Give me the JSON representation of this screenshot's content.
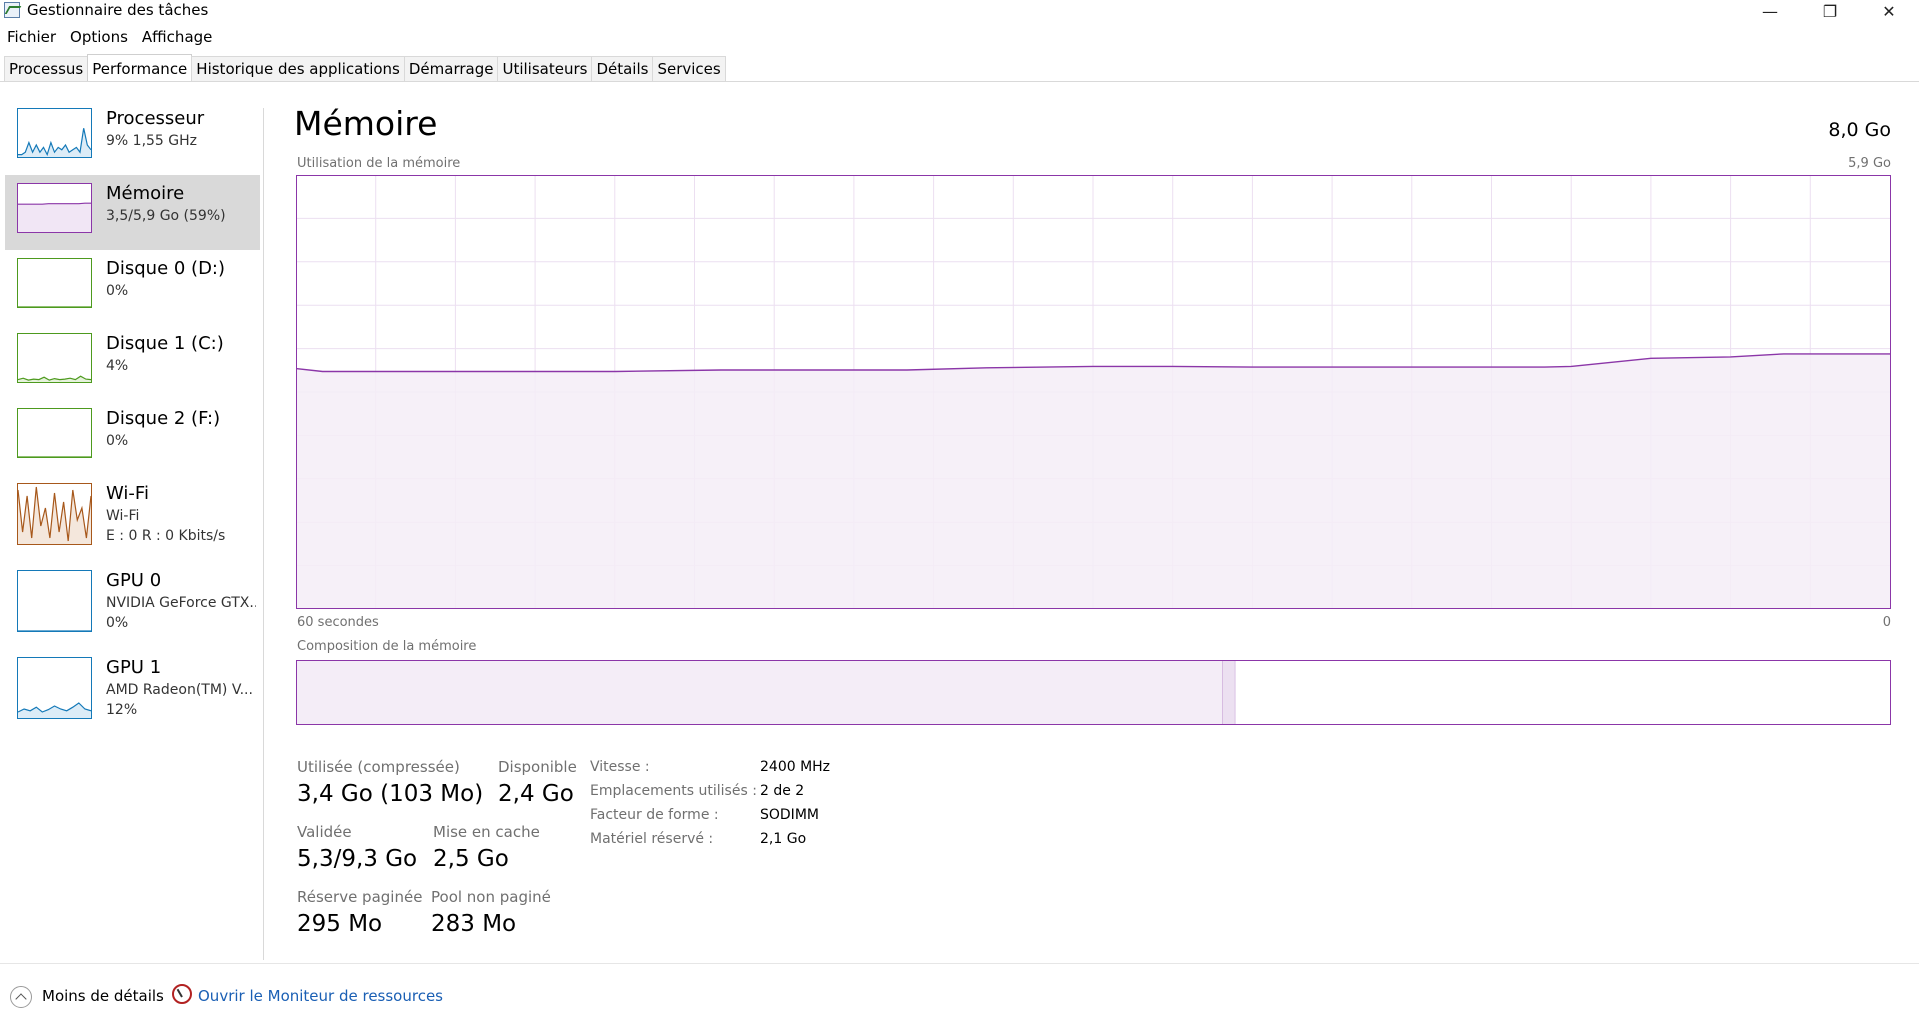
{
  "window": {
    "title": "Gestionnaire des tâches",
    "min_glyph": "—",
    "max_glyph": "❐",
    "close_glyph": "✕"
  },
  "menu": [
    "Fichier",
    "Options",
    "Affichage"
  ],
  "tabs": [
    {
      "label": "Processus",
      "active": false
    },
    {
      "label": "Performance",
      "active": true
    },
    {
      "label": "Historique des applications",
      "active": false
    },
    {
      "label": "Démarrage",
      "active": false
    },
    {
      "label": "Utilisateurs",
      "active": false
    },
    {
      "label": "Détails",
      "active": false
    },
    {
      "label": "Services",
      "active": false
    }
  ],
  "sidebar": {
    "items": [
      {
        "name": "Processeur",
        "sub": "9%  1,55 GHz",
        "sub2": "",
        "color": "#1479b8",
        "fill": "#dcecf7",
        "selected": false,
        "spark": [
          0.05,
          0.05,
          0.1,
          0.3,
          0.1,
          0.25,
          0.1,
          0.2,
          0.05,
          0.3,
          0.1,
          0.2,
          0.15,
          0.25,
          0.1,
          0.15,
          0.2,
          0.1,
          0.6,
          0.25,
          0.15
        ]
      },
      {
        "name": "Mémoire",
        "sub": "3,5/5,9 Go (59%)",
        "sub2": "",
        "color": "#8b36a8",
        "fill": "#f1e6f5",
        "selected": true,
        "spark": [
          0.58,
          0.58,
          0.58,
          0.58,
          0.58,
          0.59,
          0.59,
          0.59,
          0.59,
          0.59,
          0.59,
          0.6,
          0.6
        ]
      },
      {
        "name": "Disque 0 (D:)",
        "sub": "0%",
        "sub2": "",
        "color": "#4d9a1e",
        "fill": "#e6f2dc",
        "selected": false,
        "spark": [
          0,
          0,
          0,
          0,
          0,
          0,
          0,
          0,
          0,
          0
        ]
      },
      {
        "name": "Disque 1 (C:)",
        "sub": "4%",
        "sub2": "",
        "color": "#4d9a1e",
        "fill": "#e6f2dc",
        "selected": false,
        "spark": [
          0.05,
          0.08,
          0.04,
          0.06,
          0.05,
          0.1,
          0.04,
          0.07,
          0.05,
          0.06,
          0.08,
          0.05,
          0.12,
          0.06,
          0.05
        ]
      },
      {
        "name": "Disque 2 (F:)",
        "sub": "0%",
        "sub2": "",
        "color": "#4d9a1e",
        "fill": "#e6f2dc",
        "selected": false,
        "spark": [
          0,
          0,
          0,
          0,
          0,
          0,
          0,
          0,
          0,
          0
        ]
      },
      {
        "name": "Wi-Fi",
        "sub": "Wi-Fi",
        "sub2": "E : 0  R : 0 Kbits/s",
        "color": "#a7581b",
        "fill": "#f4e7dc",
        "selected": false,
        "spark": [
          0.9,
          0.2,
          0.8,
          0.1,
          0.95,
          0.3,
          0.6,
          0.1,
          0.85,
          0.2,
          0.7,
          0.05,
          0.9,
          0.4,
          0.6,
          0.1,
          0.8
        ]
      },
      {
        "name": "GPU 0",
        "sub": "NVIDIA GeForce GTX...",
        "sub2": "0%",
        "color": "#1479b8",
        "fill": "#dcecf7",
        "selected": false,
        "spark": [
          0,
          0,
          0,
          0,
          0,
          0,
          0,
          0,
          0,
          0
        ]
      },
      {
        "name": "GPU 1",
        "sub": "AMD Radeon(TM) V...",
        "sub2": "12%",
        "color": "#1479b8",
        "fill": "#dcecf7",
        "selected": false,
        "spark": [
          0.1,
          0.15,
          0.12,
          0.18,
          0.1,
          0.14,
          0.2,
          0.15,
          0.12,
          0.18,
          0.25,
          0.15,
          0.12
        ]
      }
    ]
  },
  "main": {
    "title": "Mémoire",
    "total": "8,0 Go",
    "usage_label": "Utilisation de la mémoire",
    "usage_max": "5,9 Go",
    "time_left": "60 secondes",
    "time_right": "0",
    "composition_label": "Composition de la mémoire",
    "composition": {
      "in_use_fraction": 0.581,
      "modified_fraction": 0.008,
      "standby_fraction": 0.411
    }
  },
  "chart_data": {
    "type": "area",
    "title": "Utilisation de la mémoire",
    "xlabel": "",
    "ylabel": "",
    "x_range_seconds": [
      60,
      0
    ],
    "ylim": [
      0,
      5.9
    ],
    "grid": true,
    "x": [
      60,
      59,
      58,
      55,
      52,
      48,
      44,
      40,
      37,
      34,
      30,
      27,
      24,
      20,
      16,
      13,
      12,
      9,
      6,
      4,
      0
    ],
    "values": [
      3.27,
      3.23,
      3.23,
      3.23,
      3.23,
      3.23,
      3.25,
      3.25,
      3.25,
      3.28,
      3.3,
      3.3,
      3.29,
      3.29,
      3.29,
      3.29,
      3.3,
      3.41,
      3.43,
      3.47,
      3.47
    ]
  },
  "stats": {
    "used_label": "Utilisée (compressée)",
    "used_value": "3,4 Go (103 Mo)",
    "available_label": "Disponible",
    "available_value": "2,4 Go",
    "committed_label": "Validée",
    "committed_value": "5,3/9,3 Go",
    "cached_label": "Mise en cache",
    "cached_value": "2,5 Go",
    "paged_label": "Réserve paginée",
    "paged_value": "295 Mo",
    "nonpaged_label": "Pool non paginé",
    "nonpaged_value": "283 Mo"
  },
  "specs": [
    {
      "key": "Vitesse :",
      "value": "2400 MHz"
    },
    {
      "key": "Emplacements utilisés :",
      "value": "2 de 2"
    },
    {
      "key": "Facteur de forme :",
      "value": "SODIMM"
    },
    {
      "key": "Matériel réservé :",
      "value": "2,1 Go"
    }
  ],
  "footer": {
    "less_details": "Moins de détails",
    "resource_monitor": "Ouvrir le Moniteur de ressources"
  },
  "colors": {
    "memory": "#8b36a8",
    "memory_fill": "#f4edf7",
    "grid": "#ecdff1"
  }
}
